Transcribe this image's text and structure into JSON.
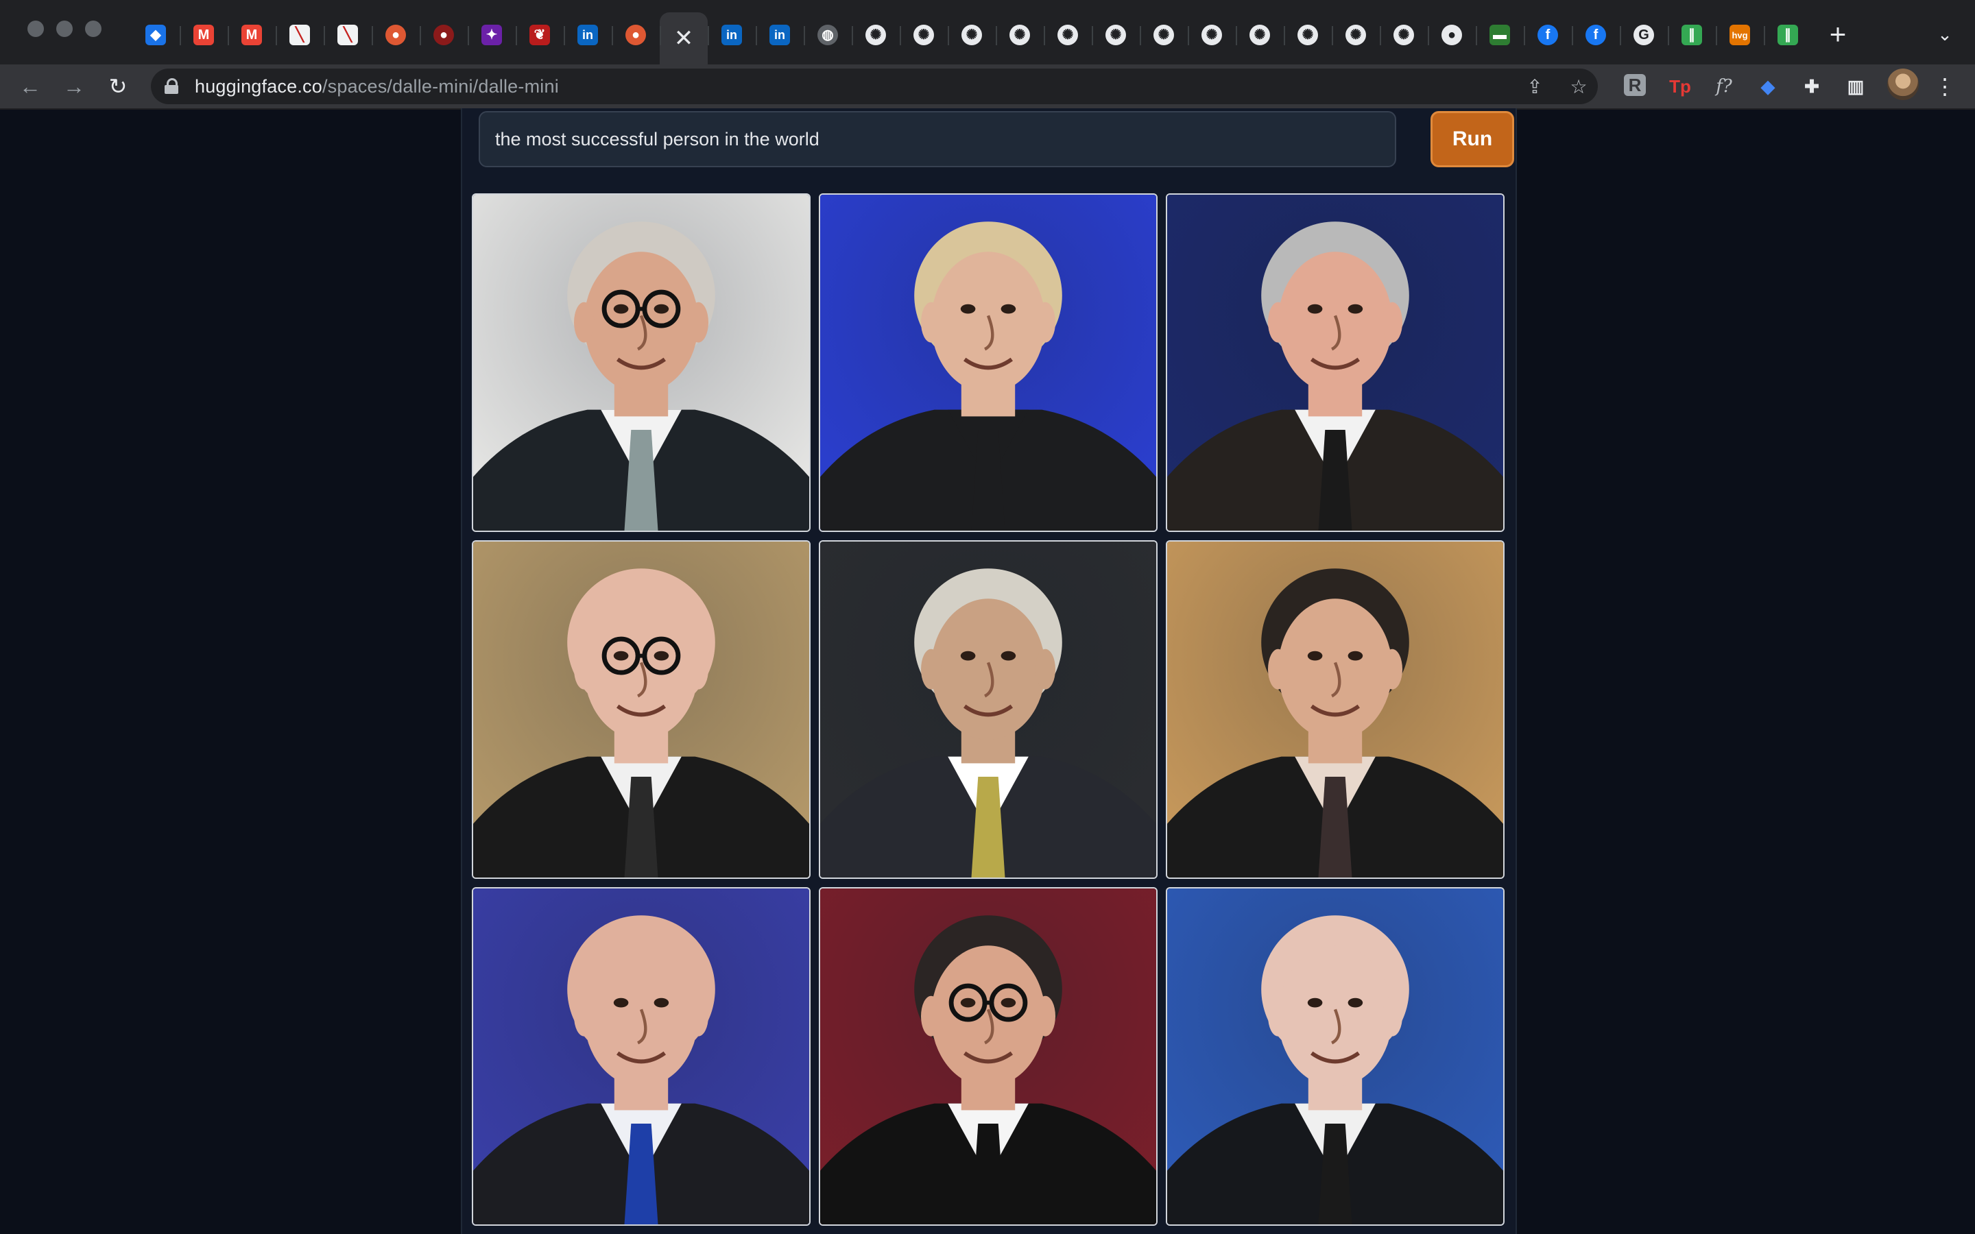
{
  "browser": {
    "tabs": [
      {
        "icon": "diamond-icon",
        "glyph": "◆",
        "bg": "#1a73e8"
      },
      {
        "icon": "gmail-icon",
        "glyph": "M",
        "bg": "#ea4335"
      },
      {
        "icon": "gmail-icon",
        "glyph": "M",
        "bg": "#ea4335"
      },
      {
        "icon": "papers-icon",
        "glyph": "╲",
        "bg": "#f1f3f4"
      },
      {
        "icon": "papers-icon",
        "glyph": "╲",
        "bg": "#f1f3f4"
      },
      {
        "icon": "duckduckgo-icon",
        "glyph": "●",
        "bg": "#de5833"
      },
      {
        "icon": "record-icon",
        "glyph": "●",
        "bg": "#8b1a1a"
      },
      {
        "icon": "purple-app-icon",
        "glyph": "✦",
        "bg": "#6b21a8"
      },
      {
        "icon": "red-bird-icon",
        "glyph": "❦",
        "bg": "#b91c1c"
      },
      {
        "icon": "linkedin-icon",
        "glyph": "in",
        "bg": "#0a66c2"
      },
      {
        "icon": "duckduckgo-icon",
        "glyph": "●",
        "bg": "#de5833"
      },
      {
        "icon": "close-icon",
        "glyph": "✕",
        "bg": "transparent",
        "active": true
      },
      {
        "icon": "linkedin-icon",
        "glyph": "in",
        "bg": "#0a66c2"
      },
      {
        "icon": "linkedin-icon",
        "glyph": "in",
        "bg": "#0a66c2"
      },
      {
        "icon": "globe-icon",
        "glyph": "◍",
        "bg": "#5f6368"
      },
      {
        "icon": "openai-icon",
        "glyph": "✺",
        "bg": "#202124"
      },
      {
        "icon": "openai-icon",
        "glyph": "✺",
        "bg": "#202124"
      },
      {
        "icon": "openai-icon",
        "glyph": "✺",
        "bg": "#202124"
      },
      {
        "icon": "openai-icon",
        "glyph": "✺",
        "bg": "#202124"
      },
      {
        "icon": "openai-icon",
        "glyph": "✺",
        "bg": "#202124"
      },
      {
        "icon": "openai-icon",
        "glyph": "✺",
        "bg": "#202124"
      },
      {
        "icon": "openai-icon",
        "glyph": "✺",
        "bg": "#202124"
      },
      {
        "icon": "openai-icon",
        "glyph": "✺",
        "bg": "#202124"
      },
      {
        "icon": "openai-icon",
        "glyph": "✺",
        "bg": "#202124"
      },
      {
        "icon": "openai-icon",
        "glyph": "✺",
        "bg": "#202124"
      },
      {
        "icon": "openai-icon",
        "glyph": "✺",
        "bg": "#202124"
      },
      {
        "icon": "openai-icon",
        "glyph": "✺",
        "bg": "#202124"
      },
      {
        "icon": "github-icon",
        "glyph": "●",
        "bg": "#202124"
      },
      {
        "icon": "green-card-icon",
        "glyph": "▬",
        "bg": "#2e7d32"
      },
      {
        "icon": "facebook-icon",
        "glyph": "f",
        "bg": "#1877f2"
      },
      {
        "icon": "facebook-icon",
        "glyph": "f",
        "bg": "#1877f2"
      },
      {
        "icon": "grammarly-icon",
        "glyph": "G",
        "bg": "#202124"
      },
      {
        "icon": "teal-slash-icon",
        "glyph": "∥",
        "bg": "#34a853"
      },
      {
        "icon": "hvg-icon",
        "glyph": "hvg",
        "bg": "#e37400"
      },
      {
        "icon": "teal-slash-icon",
        "glyph": "∥",
        "bg": "#34a853"
      }
    ],
    "new_tab_glyph": "+",
    "tab_list_glyph": "⌄",
    "url_host": "huggingface.co",
    "url_path": "/spaces/dalle-mini/dalle-mini",
    "nav": {
      "back": "←",
      "forward": "→",
      "reload": "↻"
    },
    "omnibox_icons": {
      "share": "⇪",
      "bookmark": "☆"
    },
    "extensions": [
      {
        "icon": "raindrop-icon",
        "glyph": "R",
        "color": "#9aa0a6"
      },
      {
        "icon": "tp-icon",
        "glyph": "Tp",
        "color": "#e53935"
      },
      {
        "icon": "font-finder-icon",
        "glyph": "f?",
        "color": "#bdc1c6"
      },
      {
        "icon": "diamond-icon",
        "glyph": "◆",
        "color": "#4285f4"
      },
      {
        "icon": "puzzle-icon",
        "glyph": "✚",
        "color": "#e8eaed"
      },
      {
        "icon": "side-panel-icon",
        "glyph": "▥",
        "color": "#e8eaed"
      }
    ],
    "menu_glyph": "⋮"
  },
  "app": {
    "prompt_value": "the most successful person in the world",
    "run_label": "Run",
    "accent": "#c2651a",
    "images": [
      {
        "name": "result-image-1",
        "bg": "#e9e9e7",
        "skin": "#d9a58a",
        "hair": "#cfcac3",
        "suit": "#1e2328",
        "shirt": "#f2f2f2",
        "tie": "#8a9a9a",
        "glasses": true
      },
      {
        "name": "result-image-2",
        "bg": "#2b3fd1",
        "skin": "#e0b49a",
        "hair": "#d9c59a",
        "suit": "#1c1d1f",
        "shirt": "#1c1d1f",
        "tie": "#1c1d1f",
        "glasses": false
      },
      {
        "name": "result-image-3",
        "bg": "#1d2a6b",
        "skin": "#e2a993",
        "hair": "#b9b9b9",
        "suit": "#26221f",
        "shirt": "#f2f2f2",
        "tie": "#1a1a1a",
        "glasses": false
      },
      {
        "name": "result-image-4",
        "bg": "#b69a6a",
        "skin": "#e4b8a4",
        "hair": "#e4b8a4",
        "suit": "#1a1a1a",
        "shirt": "#f0f0f0",
        "tie": "#2a2a2a",
        "glasses": true
      },
      {
        "name": "result-image-5",
        "bg": "#2b2d30",
        "skin": "#c9a183",
        "hair": "#d4d0c6",
        "suit": "#272930",
        "shirt": "#ffffff",
        "tie": "#b8a94a",
        "glasses": false
      },
      {
        "name": "result-image-6",
        "bg": "#c99a5c",
        "skin": "#d9a98c",
        "hair": "#2a2420",
        "suit": "#1a1a1a",
        "shirt": "#e8d8cc",
        "tie": "#3a2e2e",
        "glasses": false
      },
      {
        "name": "result-image-7",
        "bg": "#3a3fa8",
        "skin": "#e0b09c",
        "hair": "#e0b09c",
        "suit": "#1c1d22",
        "shirt": "#eef0f5",
        "tie": "#1e3fa8",
        "glasses": false
      },
      {
        "name": "result-image-8",
        "bg": "#7a1f2a",
        "skin": "#d9a48a",
        "hair": "#2b2524",
        "suit": "#121212",
        "shirt": "#f5f5f5",
        "tie": "#121212",
        "glasses": true
      },
      {
        "name": "result-image-9",
        "bg": "#2e5bb8",
        "skin": "#e6c3b5",
        "hair": "#e6c3b5",
        "suit": "#16181c",
        "shirt": "#f0f0f0",
        "tie": "#1a1a1a",
        "glasses": false
      }
    ]
  }
}
